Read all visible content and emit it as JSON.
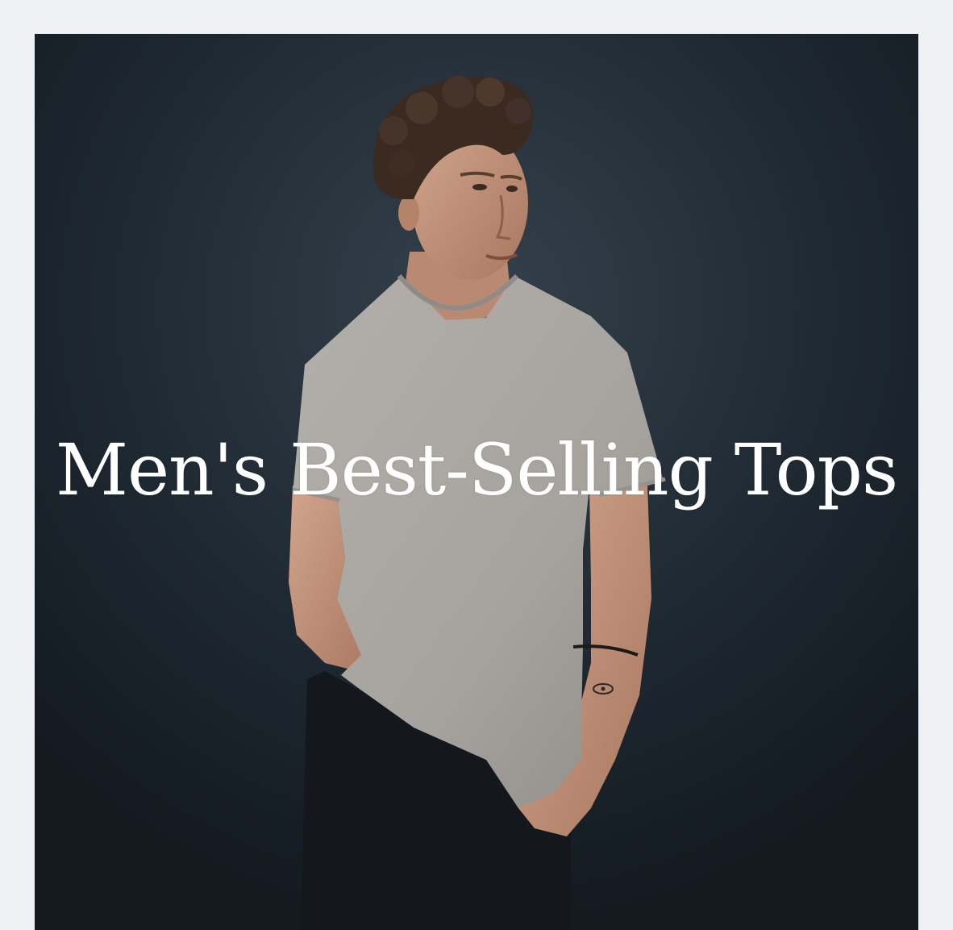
{
  "hero": {
    "headline": "Men's Best-Selling Tops",
    "image": {
      "subject": "model-wearing-grey-tshirt",
      "colors": {
        "background": "#1f2a33",
        "tshirt": "#a9a6a1",
        "skin": "#c89a82",
        "hair": "#3a2a20",
        "shorts": "#14181c"
      }
    }
  }
}
